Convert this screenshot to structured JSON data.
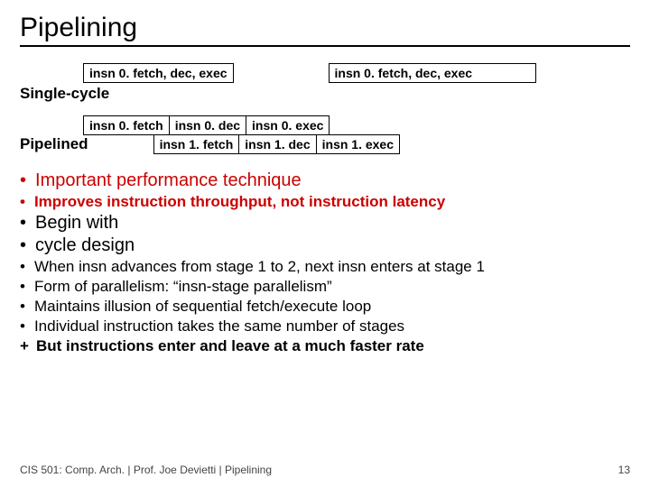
{
  "title": "Pipelining",
  "diagram": {
    "single_cycle_label": "Single-cycle",
    "pipelined_label": "Pipelined",
    "sc_box1": "insn 0. fetch, dec, exec",
    "sc_box2": "insn 0. fetch, dec, exec",
    "p_row1_c1": "insn 0. fetch",
    "p_row1_c2": "insn 0. dec",
    "p_row1_c3": "insn 0. exec",
    "p_row2_c1": "insn 1. fetch",
    "p_row2_c2": "insn 1. dec",
    "p_row2_c3": "insn 1. exec"
  },
  "bullets": {
    "b1": "Important performance technique",
    "b2": "Improves instruction throughput, not instruction latency",
    "b3a": "Begin with",
    "b3b": "cycle design",
    "b4a": "When insn advances from stage 1 to 2, next insn enters at stage 1",
    "b4b": "Form of parallelism: “insn-stage parallelism”",
    "b4c": "Maintains illusion of sequential fetch/execute loop",
    "b4d": "Individual instruction takes the same number of stages",
    "b4e": "But instructions enter and leave at a much faster rate"
  },
  "footer": {
    "left": "CIS 501: Comp. Arch.  |  Prof. Joe Devietti  |  Pipelining",
    "right": "13"
  }
}
